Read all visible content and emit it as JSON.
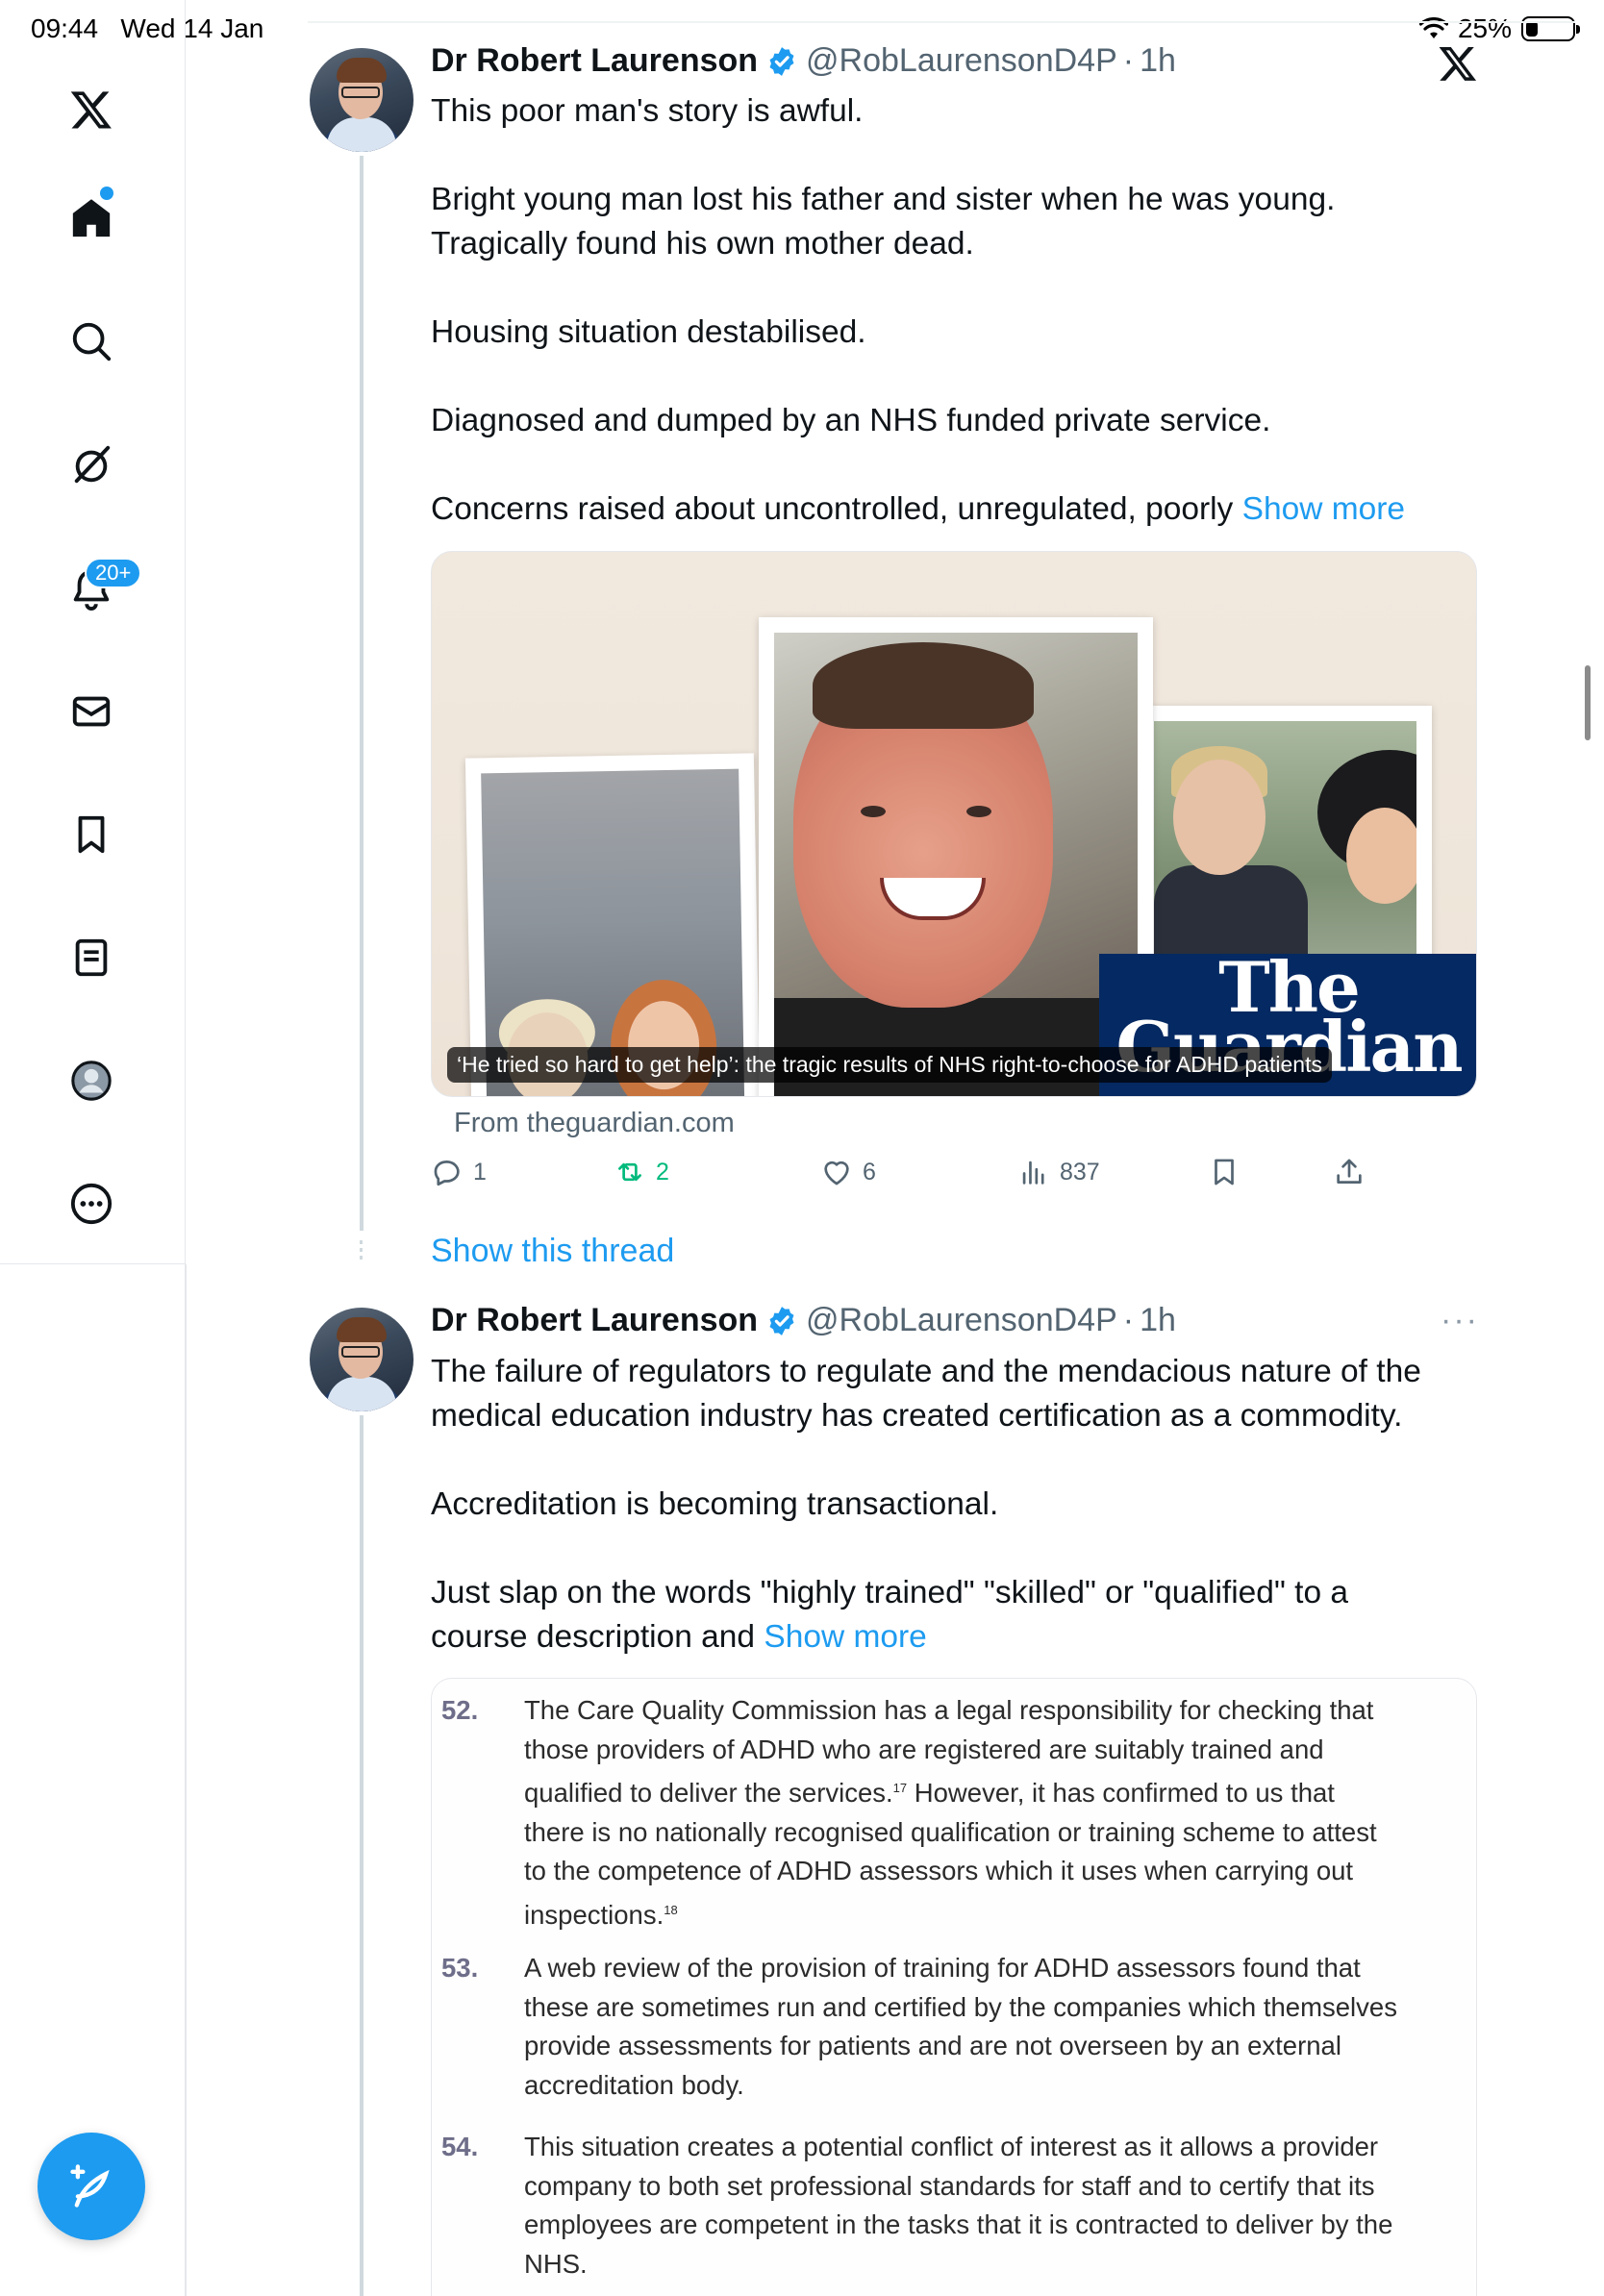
{
  "status_bar": {
    "time": "09:44",
    "date": "Wed 14 Jan",
    "battery_text": "25%",
    "battery_level": 0.25
  },
  "sidebar": {
    "items": [
      {
        "name": "x-logo-icon"
      },
      {
        "name": "home-icon"
      },
      {
        "name": "search-icon"
      },
      {
        "name": "grok-icon"
      },
      {
        "name": "notifications-icon"
      },
      {
        "name": "messages-icon"
      },
      {
        "name": "bookmarks-icon"
      },
      {
        "name": "lists-icon"
      },
      {
        "name": "profile-icon"
      },
      {
        "name": "more-icon"
      }
    ],
    "notification_badge": "20+",
    "compose_icon": "compose-feather-icon"
  },
  "colors": {
    "accent": "#1d9bf0",
    "retweet": "#00ba7c",
    "muted": "#536471",
    "guardian_blue": "#052962"
  },
  "tweet1": {
    "author": "Dr Robert Laurenson",
    "handle": "@RobLaurensonD4P",
    "separator": "·",
    "time": "1h",
    "text_lines": [
      "This poor man's story is awful.",
      "Bright young man lost his father and sister when he was young.",
      "Tragically found his own mother dead.",
      "Housing situation destabilised.",
      "Diagnosed and dumped by an NHS funded private service.",
      "Concerns raised about uncontrolled, unregulated, poorly"
    ],
    "show_more": "Show more",
    "card": {
      "logo_line1": "The",
      "logo_line2": "Guardian",
      "caption": "‘He tried so hard to get help’: the tragic results of NHS right-to-choose for ADHD patients",
      "source": "From theguardian.com"
    },
    "actions": {
      "replies": "1",
      "retweets": "2",
      "likes": "6",
      "views": "837"
    },
    "show_thread": "Show this thread"
  },
  "tweet2": {
    "author": "Dr Robert Laurenson",
    "handle": "@RobLaurensonD4P",
    "separator": "·",
    "time": "1h",
    "more": "···",
    "text_lines": [
      "The failure of regulators to regulate and the mendacious nature of the",
      "medical education industry has created certification as a commodity.",
      "Accreditation is becoming transactional.",
      "Just slap on the words \"highly trained\" \"skilled\" or \"qualified\" to a",
      "course description and"
    ],
    "show_more": "Show more",
    "document": [
      {
        "number": "52.",
        "lines": [
          "The Care Quality Commission has a legal responsibility for checking that",
          "those providers of ADHD who are registered are suitably trained and",
          "qualified to deliver the services.",
          "there is no nationally recognised qualification or training scheme to attest",
          "to the competence of ADHD assessors which it uses when carrying out",
          "inspections."
        ],
        "footnote_a": "17",
        "line3_tail": " However, it has confirmed to us that",
        "footnote_b": "18"
      },
      {
        "number": "53.",
        "lines": [
          "A web review of the provision of training for ADHD assessors found that",
          "these are sometimes run and certified by the companies which themselves",
          "provide assessments for patients and are not overseen by an external",
          "accreditation body."
        ]
      },
      {
        "number": "54.",
        "lines": [
          "This situation creates a potential conflict of interest as it allows a provider",
          "company to both set professional standards for staff and to certify that its",
          "employees are competent in the tasks that it is contracted to deliver by the",
          "NHS."
        ]
      }
    ]
  }
}
